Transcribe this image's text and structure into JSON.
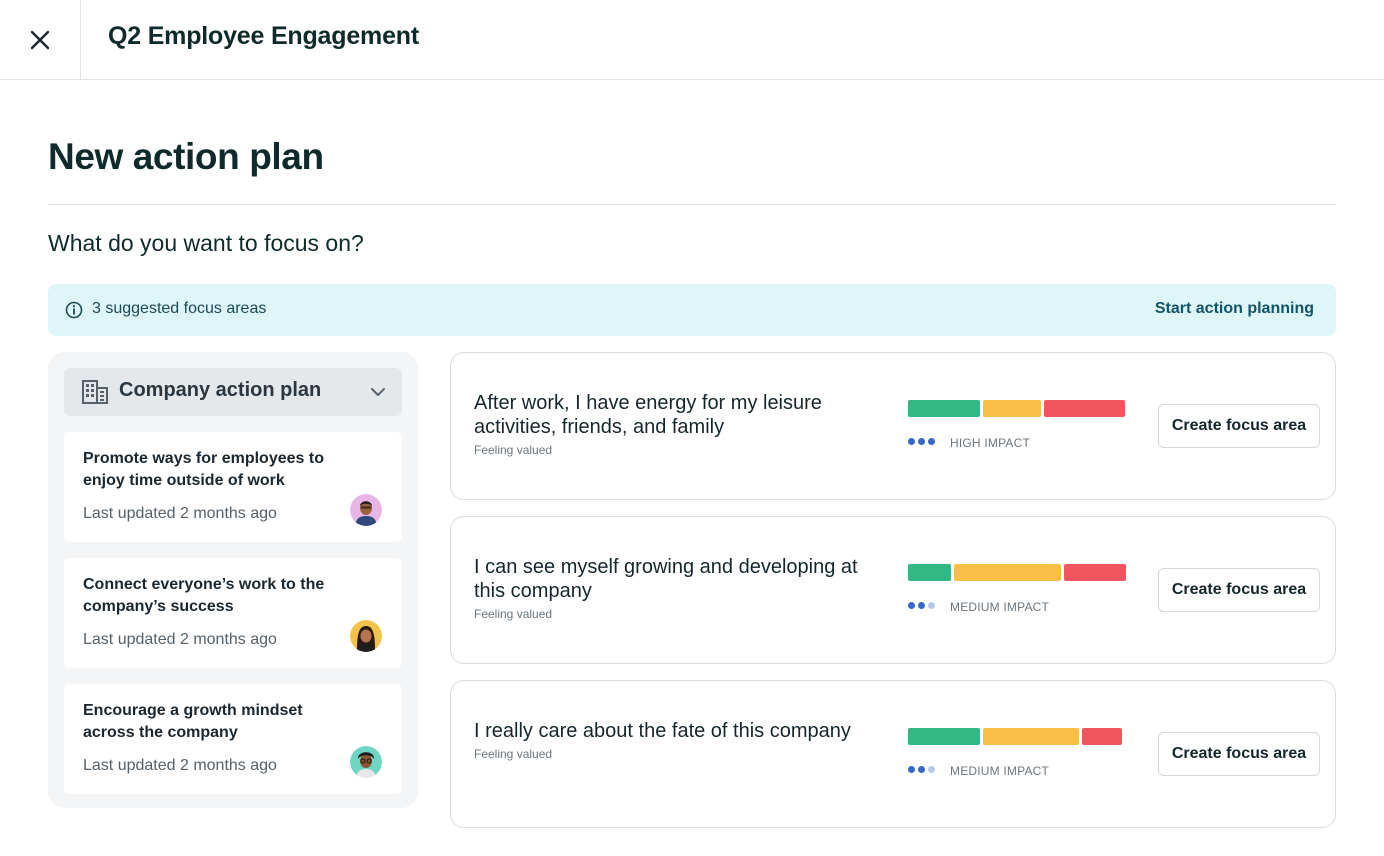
{
  "header": {
    "title": "Q2 Employee Engagement",
    "close_icon": "close-icon"
  },
  "page": {
    "title": "New action plan",
    "question": "What do you want to focus on?"
  },
  "banner": {
    "text": "3 suggested focus areas",
    "link": "Start action planning",
    "icon": "info-icon"
  },
  "sidebar": {
    "dropdown_label": "Company action plan",
    "plans": [
      {
        "title": "Promote ways for employees to enjoy time outside of work",
        "meta": "Last updated 2 months ago"
      },
      {
        "title": "Connect everyone’s work to the company’s success",
        "meta": "Last updated 2 months ago"
      },
      {
        "title": "Encourage a growth mindset across the company",
        "meta": "Last updated 2 months ago"
      }
    ]
  },
  "focus_items": [
    {
      "title": "After work, I have energy for my leisure activities, friends, and family",
      "subtitle": "Feeling valued",
      "impact": "HIGH IMPACT",
      "impact_level": 3,
      "distribution": [
        0.34,
        0.27,
        0.38
      ],
      "button": "Create focus area"
    },
    {
      "title": "I can see myself growing and developing at this company",
      "subtitle": "Feeling valued",
      "impact": "MEDIUM IMPACT",
      "impact_level": 2,
      "distribution": [
        0.2,
        0.5,
        0.29
      ],
      "button": "Create focus area"
    },
    {
      "title": "I really care about the fate of this company",
      "subtitle": "Feeling valued",
      "impact": "MEDIUM IMPACT",
      "impact_level": 2,
      "distribution": [
        0.34,
        0.45,
        0.19
      ],
      "button": "Create focus area"
    }
  ],
  "colors": {
    "positive": "#33b784",
    "neutral": "#f8be46",
    "negative": "#f1565f",
    "dot_active": "#3568c8",
    "dot_inactive": "#b6c8ea"
  }
}
